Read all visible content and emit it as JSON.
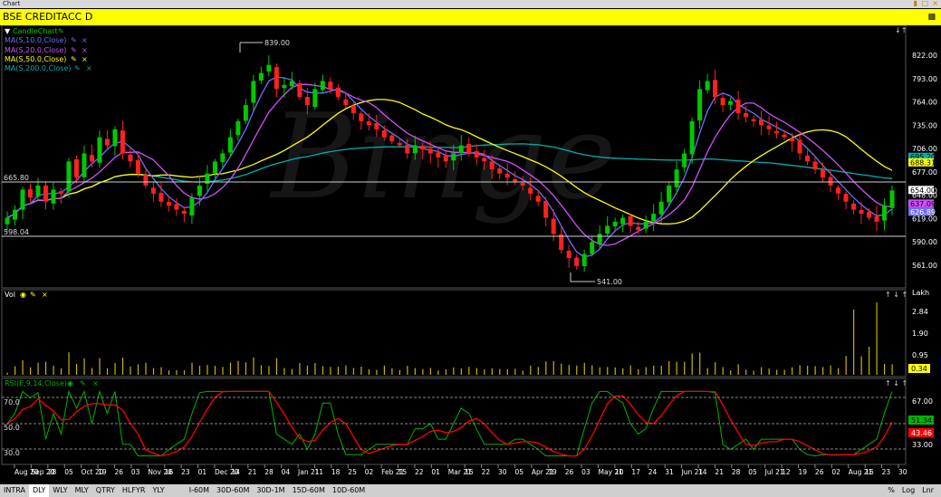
{
  "window": {
    "title": "Chart"
  },
  "symbol": {
    "name": "BSE CREDITACC D"
  },
  "legend": {
    "candle": "CandleChart",
    "ma10": "MA(S,10.0,Close)",
    "ma20": "MA(S,20.0,Close)",
    "ma50": "MA(S,50.0,Close)",
    "ma200": "MA(S,200.0,Close)",
    "vol": "Vol",
    "rsi": "RSI(E,9,14,Close)"
  },
  "colors": {
    "up": "#00c800",
    "down": "#ff2020",
    "ma10": "#6f6fff",
    "ma20": "#d050ff",
    "ma50": "#ffff00",
    "ma200": "#00b0b0",
    "volume": "#c8b400",
    "rsi": "#00b400",
    "rsi_signal": "#ff0000"
  },
  "bottom_bar": {
    "left": [
      "INTRA",
      "DLY",
      "WLY",
      "MLY",
      "QTRY",
      "HLFYR",
      "YLY"
    ],
    "intervals": [
      "I-60M",
      "30D-60M",
      "30D-1M",
      "15D-60M",
      "10D-60M"
    ],
    "right": [
      "%",
      "Log",
      "Lnr"
    ],
    "selected": "DLY"
  },
  "chart_data": [
    {
      "type": "candlestick",
      "title": "BSE CREDITACC D",
      "ylim": [
        541,
        822
      ],
      "y_ticks": [
        "822.00",
        "793.00",
        "764.00",
        "735.00",
        "706.00",
        "677.00",
        "654.00",
        "648.00",
        "619.00",
        "590.00",
        "561.00"
      ],
      "annotations": {
        "high": "839.00",
        "low": "541.00",
        "hline_1": "665.80",
        "hline_2": "598.04"
      },
      "right_value_labels": {
        "ma200": "695.20",
        "ma50": "688.31",
        "close": "654.00",
        "ma20": "637.09",
        "ma10": "626.89"
      },
      "x_ticks": [
        "Aug 20",
        "Sep 20",
        "28",
        "05",
        "Oct 20",
        "19",
        "26",
        "03",
        "Nov 20",
        "16",
        "23",
        "01",
        "Dec 20",
        "14",
        "21",
        "28",
        "04",
        "Jan 21",
        "11",
        "18",
        "25",
        "02",
        "Feb 21",
        "15",
        "22",
        "01",
        "Mar 21",
        "15",
        "22",
        "30",
        "05",
        "Apr 21",
        "19",
        "26",
        "03",
        "May 21",
        "10",
        "17",
        "24",
        "31",
        "Jun 21",
        "14",
        "21",
        "28",
        "05",
        "Jul 21",
        "12",
        "19",
        "26",
        "02",
        "Aug 21",
        "16",
        "23",
        "30"
      ],
      "close": [
        620,
        630,
        655,
        645,
        660,
        640,
        655,
        650,
        690,
        670,
        700,
        690,
        720,
        710,
        730,
        700,
        690,
        675,
        660,
        650,
        640,
        635,
        630,
        625,
        645,
        660,
        675,
        690,
        700,
        720,
        740,
        760,
        790,
        800,
        810,
        780,
        785,
        790,
        770,
        760,
        780,
        790,
        780,
        770,
        760,
        750,
        740,
        735,
        730,
        720,
        715,
        710,
        700,
        710,
        705,
        700,
        695,
        690,
        700,
        710,
        700,
        695,
        690,
        680,
        675,
        670,
        665,
        660,
        650,
        640,
        620,
        600,
        580,
        570,
        560,
        575,
        590,
        600,
        610,
        615,
        620,
        610,
        605,
        615,
        625,
        640,
        660,
        680,
        700,
        740,
        780,
        790,
        770,
        760,
        765,
        750,
        745,
        740,
        735,
        730,
        725,
        720,
        715,
        700,
        690,
        680,
        670,
        660,
        650,
        640,
        630,
        625,
        620,
        615,
        635,
        654
      ]
    },
    {
      "type": "bar",
      "title": "Vol",
      "ylabel": "Lakh",
      "y_ticks": [
        "2.84",
        "1.90",
        "0.95"
      ],
      "current": "0.34"
    },
    {
      "type": "line",
      "title": "RSI(E,9,14,Close)",
      "y_ticks": [
        "67.00",
        "33.00"
      ],
      "levels": [
        "70.0",
        "50.0",
        "30.0"
      ],
      "current_rsi": "51.34",
      "current_signal": "43.46"
    }
  ]
}
